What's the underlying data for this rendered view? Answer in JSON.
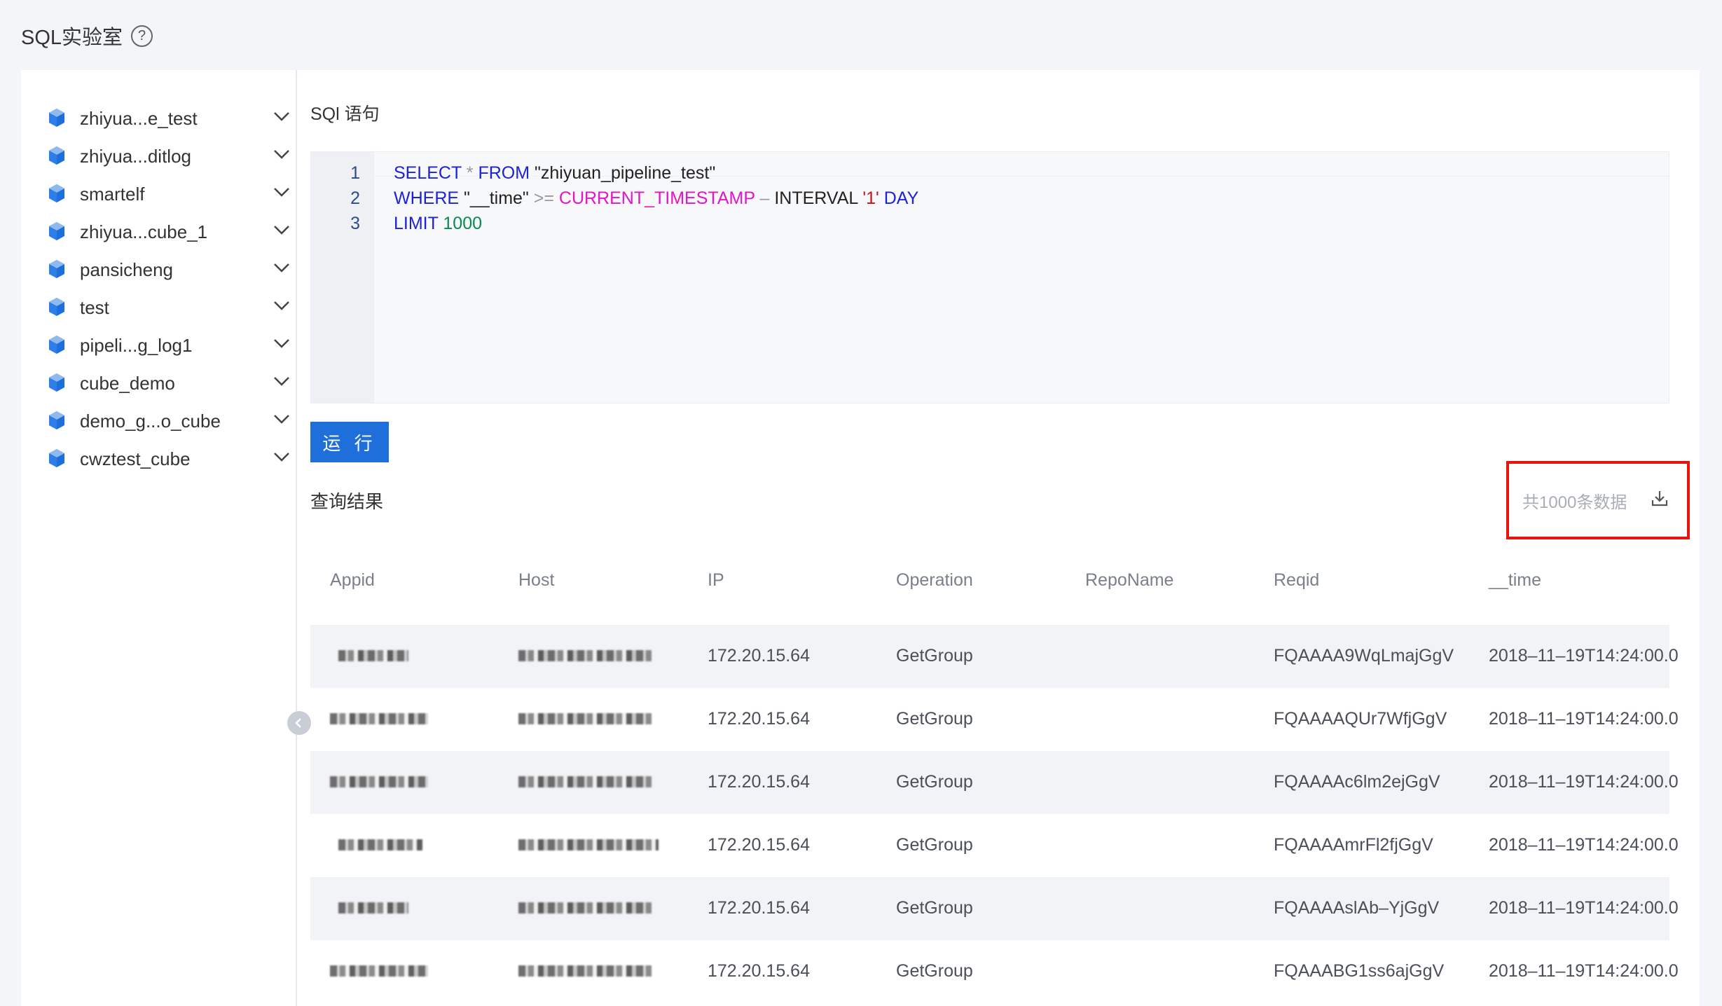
{
  "page": {
    "title": "SQL实验室",
    "help_glyph": "?"
  },
  "sidebar": {
    "items": [
      {
        "label": "zhiyua...e_test"
      },
      {
        "label": "zhiyua...ditlog"
      },
      {
        "label": "smartelf"
      },
      {
        "label": "zhiyua...cube_1"
      },
      {
        "label": "pansicheng"
      },
      {
        "label": "test"
      },
      {
        "label": "pipeli...g_log1"
      },
      {
        "label": "cube_demo"
      },
      {
        "label": "demo_g...o_cube"
      },
      {
        "label": "cwztest_cube"
      }
    ]
  },
  "editor": {
    "heading": "SQl 语句",
    "line_numbers": [
      "1",
      "2",
      "3"
    ],
    "line1": {
      "kw1": "SELECT",
      "op": " * ",
      "kw2": "FROM",
      "str": " \"zhiyuan_pipeline_test\""
    },
    "line2": {
      "kw1": "WHERE",
      "plain1": " \"__time\" ",
      "op": ">=",
      "fn": " CURRENT_TIMESTAMP",
      "op2": " – ",
      "plain2": "INTERVAL ",
      "lit": "'1'",
      "kw2": " DAY"
    },
    "line3": {
      "kw1": "LIMIT",
      "num": " 1000"
    }
  },
  "run_button": {
    "label": "运 行"
  },
  "results": {
    "heading": "查询结果",
    "total": "共1000条数据",
    "columns": [
      "Appid",
      "Host",
      "IP",
      "Operation",
      "RepoName",
      "Reqid",
      "__time"
    ],
    "rows": [
      {
        "ip": "172.20.15.64",
        "operation": "GetGroup",
        "repo": "",
        "reqid": "FQAAAA9WqLmajGgV",
        "time": "2018–11–19T14:24:00.0"
      },
      {
        "ip": "172.20.15.64",
        "operation": "GetGroup",
        "repo": "",
        "reqid": "FQAAAAQUr7WfjGgV",
        "time": "2018–11–19T14:24:00.0"
      },
      {
        "ip": "172.20.15.64",
        "operation": "GetGroup",
        "repo": "",
        "reqid": "FQAAAAc6lm2ejGgV",
        "time": "2018–11–19T14:24:00.0"
      },
      {
        "ip": "172.20.15.64",
        "operation": "GetGroup",
        "repo": "",
        "reqid": "FQAAAAmrFl2fjGgV",
        "time": "2018–11–19T14:24:00.0"
      },
      {
        "ip": "172.20.15.64",
        "operation": "GetGroup",
        "repo": "",
        "reqid": "FQAAAAslAb–YjGgV",
        "time": "2018–11–19T14:24:00.0"
      },
      {
        "ip": "172.20.15.64",
        "operation": "GetGroup",
        "repo": "",
        "reqid": "FQAAABG1ss6ajGgV",
        "time": "2018–11–19T14:24:00.0"
      }
    ]
  },
  "icons": {
    "cube": "cube-icon",
    "chevron": "chevron-down-icon",
    "download": "download-icon",
    "collapse": "chevron-left-icon"
  },
  "colors": {
    "accent": "#1e6fd9",
    "highlight": "#e8150c",
    "cube": "#1e6fd9"
  }
}
